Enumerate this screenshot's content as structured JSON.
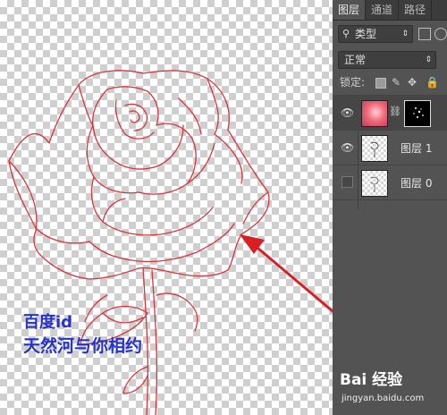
{
  "panel": {
    "tabs": [
      {
        "label": "图层"
      },
      {
        "label": "通道"
      },
      {
        "label": "路径"
      }
    ],
    "filter": {
      "icon": "search-icon",
      "label": "类型"
    },
    "blend_mode": "正常",
    "lock_label": "锁定:",
    "layers": [
      {
        "name": "",
        "type": "masked-photo",
        "visible": true
      },
      {
        "name": "图层 1",
        "visible": true
      },
      {
        "name": "图层 0",
        "visible": false
      }
    ]
  },
  "watermark": {
    "line1": "百度id",
    "line2": "天然河与你相约"
  },
  "logo": {
    "text": "Bai 经验",
    "url": "jingyan.baidu.com"
  },
  "colors": {
    "sketch": "#d9343c",
    "arrow": "#d81f26",
    "watermark": "#2633c9",
    "panel_bg": "#535353"
  }
}
